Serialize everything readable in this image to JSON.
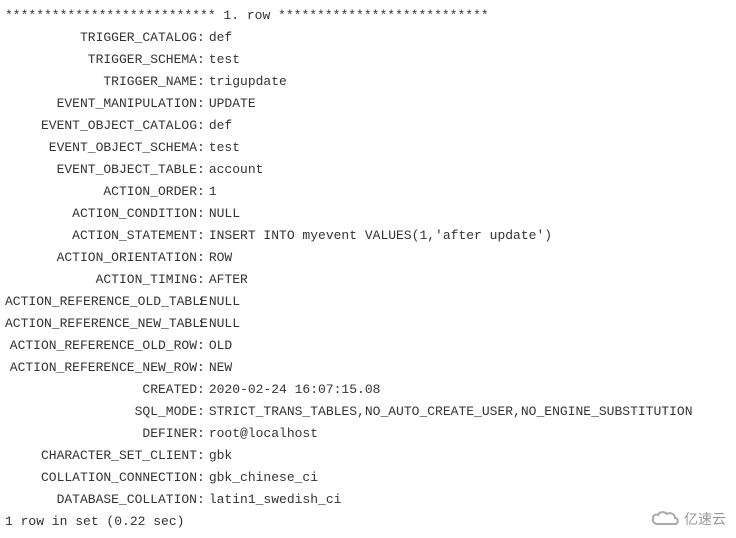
{
  "row_header": "*************************** 1. row ***************************",
  "fields": [
    {
      "label": "TRIGGER_CATALOG",
      "value": "def"
    },
    {
      "label": "TRIGGER_SCHEMA",
      "value": "test"
    },
    {
      "label": "TRIGGER_NAME",
      "value": "trigupdate"
    },
    {
      "label": "EVENT_MANIPULATION",
      "value": "UPDATE"
    },
    {
      "label": "EVENT_OBJECT_CATALOG",
      "value": "def"
    },
    {
      "label": "EVENT_OBJECT_SCHEMA",
      "value": "test"
    },
    {
      "label": "EVENT_OBJECT_TABLE",
      "value": "account"
    },
    {
      "label": "ACTION_ORDER",
      "value": "1"
    },
    {
      "label": "ACTION_CONDITION",
      "value": "NULL"
    },
    {
      "label": "ACTION_STATEMENT",
      "value": "INSERT INTO myevent VALUES(1,'after update')"
    },
    {
      "label": "ACTION_ORIENTATION",
      "value": "ROW"
    },
    {
      "label": "ACTION_TIMING",
      "value": "AFTER"
    },
    {
      "label": "ACTION_REFERENCE_OLD_TABLE",
      "value": "NULL"
    },
    {
      "label": "ACTION_REFERENCE_NEW_TABLE",
      "value": "NULL"
    },
    {
      "label": "ACTION_REFERENCE_OLD_ROW",
      "value": "OLD"
    },
    {
      "label": "ACTION_REFERENCE_NEW_ROW",
      "value": "NEW"
    },
    {
      "label": "CREATED",
      "value": "2020-02-24 16:07:15.08"
    },
    {
      "label": "SQL_MODE",
      "value": "STRICT_TRANS_TABLES,NO_AUTO_CREATE_USER,NO_ENGINE_SUBSTITUTION"
    },
    {
      "label": "DEFINER",
      "value": "root@localhost"
    },
    {
      "label": "CHARACTER_SET_CLIENT",
      "value": "gbk"
    },
    {
      "label": "COLLATION_CONNECTION",
      "value": "gbk_chinese_ci"
    },
    {
      "label": "DATABASE_COLLATION",
      "value": "latin1_swedish_ci"
    }
  ],
  "footer": "1 row in set (0.22 sec)",
  "watermark": "亿速云"
}
